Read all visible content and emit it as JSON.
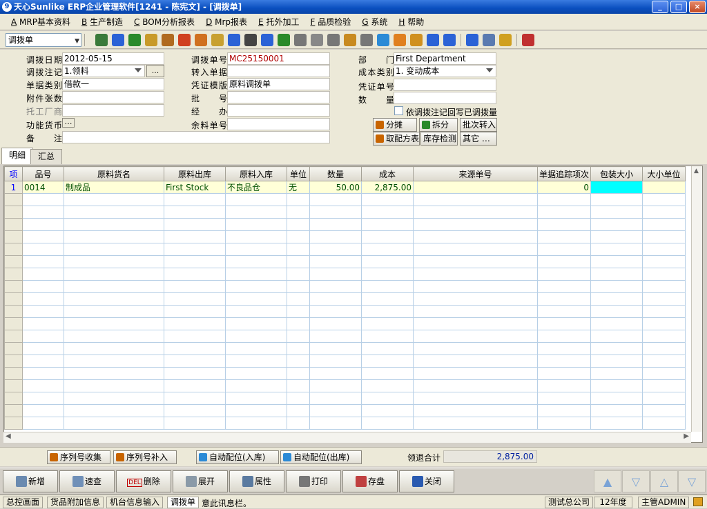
{
  "window": {
    "title": "天心Sunlike ERP企业管理软件[1241 - 陈宪文] - [调拨单]",
    "min": "_",
    "max": "□",
    "close": "×"
  },
  "menu": [
    {
      "key": "A",
      "label": " MRP基本资料"
    },
    {
      "key": "B",
      "label": " 生产制造"
    },
    {
      "key": "C",
      "label": " BOM分析报表"
    },
    {
      "key": "D",
      "label": " Mrp报表"
    },
    {
      "key": "E",
      "label": " 托外加工"
    },
    {
      "key": "F",
      "label": " 品质检验"
    },
    {
      "key": "G",
      "label": " 系统"
    },
    {
      "key": "H",
      "label": " 帮助"
    }
  ],
  "toolbar": {
    "doc_type": "调拨单",
    "icons": [
      {
        "name": "tree-icon",
        "color": "#3a7a3a"
      },
      {
        "name": "monitor-icon",
        "color": "#2b62d6"
      },
      {
        "name": "phone-icon",
        "color": "#2a8a2a"
      },
      {
        "name": "user-key-icon",
        "color": "#c89a2a"
      },
      {
        "name": "briefcase-icon",
        "color": "#b06a20"
      },
      {
        "name": "home-icon",
        "color": "#d04020"
      },
      {
        "name": "users-icon",
        "color": "#d07020"
      },
      {
        "name": "mail-icon",
        "color": "#c8a030"
      },
      {
        "name": "book-icon",
        "color": "#2b62d6"
      },
      {
        "name": "key-icon",
        "color": "#444"
      },
      {
        "name": "help-icon",
        "color": "#2b62d6"
      },
      {
        "name": "dollar-icon",
        "color": "#2a8a2a"
      },
      {
        "name": "cart-icon",
        "color": "#777"
      },
      {
        "name": "edit-doc-icon",
        "color": "#888"
      },
      {
        "name": "calculator-icon",
        "color": "#777"
      },
      {
        "name": "database-icon",
        "color": "#c88a20"
      },
      {
        "name": "copy-icon",
        "color": "#777"
      },
      {
        "name": "check-icon",
        "color": "#2b8ad6"
      },
      {
        "name": "speaker-icon",
        "color": "#e08020"
      },
      {
        "name": "hierarchy-icon",
        "color": "#d09020"
      },
      {
        "name": "screen-arrow-icon",
        "color": "#2b62d6"
      },
      {
        "name": "refresh-icon",
        "color": "#2b62d6"
      },
      {
        "name": "window-icon",
        "color": "#2b62d6"
      },
      {
        "name": "close-window-icon",
        "color": "#5a7ab0"
      },
      {
        "name": "cascade-icon",
        "color": "#d0a020"
      },
      {
        "name": "exit-icon",
        "color": "#c03030"
      }
    ]
  },
  "form": {
    "date_label": "调拨日期",
    "date_value": "2012-05-15",
    "note_label": "调拨注记",
    "note_value": "1.领料",
    "note_btn": "...",
    "billtype_label": "单据类别",
    "billtype_value": "借款一",
    "attach_label": "附件张数",
    "attach_value": "",
    "vendor_label": "托工厂商",
    "vendor_value": "",
    "currency_label": "功能货币",
    "currency_btn": "…",
    "remark_label": "备　　注",
    "remark_value": "",
    "billno_label": "调拨单号",
    "billno_value": "MC25150001",
    "transfer_label": "转入单据",
    "transfer_value": "",
    "template_label": "凭证模版",
    "template_value": "原料调拨单",
    "batch_label": "批　　号",
    "batch_value": "",
    "handler_label": "经　　办",
    "handler_value": "",
    "leftover_label": "余料单号",
    "leftover_value": "",
    "dept_label": "部　　门",
    "dept_value": "First Department",
    "cost_label": "成本类别",
    "cost_value": "1. 变动成本",
    "voucher_label": "凭证单号",
    "voucher_value": "",
    "qty_label": "数　　量",
    "qty_value": "",
    "writeback_label": "依调拨注记回写已调拨量",
    "btn_split_share": "分摊",
    "btn_split": "拆分",
    "btn_batch_in": "批次转入",
    "btn_formula": "取配方表",
    "btn_stock_check": "库存检测",
    "btn_other": "其它 …"
  },
  "tabs": [
    "明细",
    "汇总"
  ],
  "grid": {
    "headers": [
      "项",
      "品号",
      "原料货名",
      "原料出库",
      "原料入库",
      "单位",
      "数量",
      "成本",
      "来源单号",
      "单据追踪项次",
      "包装大小",
      "大小单位"
    ],
    "rows": [
      [
        "1",
        "0014",
        "制成品",
        "First Stock",
        "不良品仓",
        "无",
        "50.00",
        "2,875.00",
        "",
        "0",
        "",
        ""
      ]
    ],
    "empty_rows": 19
  },
  "bottom": {
    "serial_collect": "序列号收集",
    "serial_fill": "序列号补入",
    "auto_in": "自动配位(入库)",
    "auto_out": "自动配位(出库)",
    "total_label": "领退合计",
    "total_value": "2,875.00"
  },
  "actions": {
    "add": "新增",
    "query": "速查",
    "delete": "删除",
    "expand": "展开",
    "props": "属性",
    "print": "打印",
    "save": "存盘",
    "close": "关闭",
    "del_tag": "DEL"
  },
  "status": {
    "main": "总控画面",
    "extra": "货品附加信息",
    "machine": "机台信息输入",
    "current": "调拨单",
    "msg": "意此讯息栏。",
    "company": "测试总公司",
    "year": "12年度",
    "user": "主管ADMIN"
  }
}
